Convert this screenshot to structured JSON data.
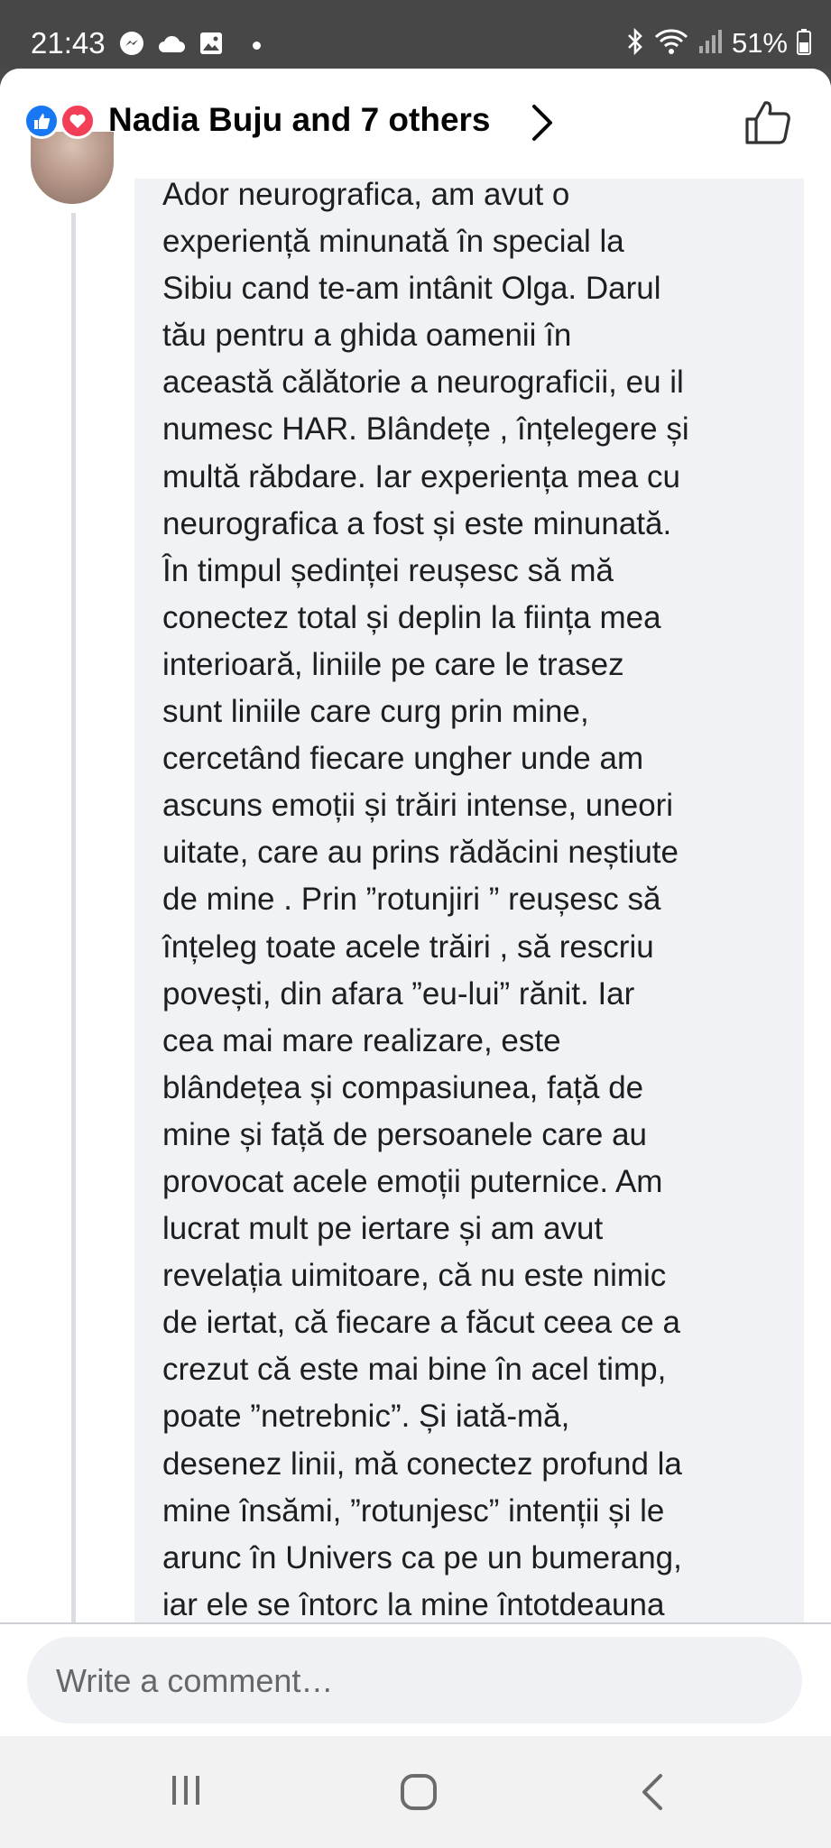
{
  "status_bar": {
    "time": "21:43",
    "battery": "51%",
    "icons": [
      "messenger-icon",
      "cloud-icon",
      "gallery-icon",
      "bluetooth-icon",
      "wifi-icon",
      "signal-icon",
      "battery-icon"
    ]
  },
  "header": {
    "reactions": [
      "like",
      "love"
    ],
    "title": "Nadia Buju and 7 others"
  },
  "comment": {
    "lines": [
      "Ador neurografica, am avut o",
      "experiență minunată în special la",
      "Sibiu cand te-am intânit Olga. Darul",
      "tău pentru a ghida oamenii în",
      "această călătorie a neurograficii, eu il",
      "numesc HAR. Blândețe , înțelegere și",
      "multă răbdare. Iar experiența mea cu",
      "neurografica a fost și este minunată.",
      "În timpul ședinței reușesc să mă",
      "conectez total și deplin la ființa mea",
      "interioară, liniile pe care le trasez",
      "sunt liniile care curg prin mine,",
      "cercetând fiecare ungher unde am",
      "ascuns emoții și trăiri intense, uneori",
      "uitate, care au prins rădăcini neștiute",
      "de mine . Prin ”rotunjiri ” reușesc să",
      "înțeleg toate acele trăiri , să rescriu",
      "povești, din afara ”eu-lui” rănit. Iar",
      "cea mai mare realizare, este",
      "blândețea și compasiunea, față de",
      "mine și față de persoanele care au",
      "provocat acele emoții puternice. Am",
      "lucrat mult pe iertare și am avut",
      "revelația uimitoare, că nu este nimic",
      "de iertat, că fiecare a făcut ceea ce a",
      "crezut că este mai bine în acel timp,",
      "poate ”netrebnic”.  Și iată-mă,",
      "desenez linii, mă conectez profund la",
      "mine însămi, ”rotunjesc” intenții și le",
      "arunc în Univers ca pe un bumerang,",
      "iar ele se întorc la mine întotdeauna"
    ]
  },
  "composer": {
    "placeholder": "Write a comment…"
  },
  "colors": {
    "accent": "#1877f2",
    "love": "#f33e58",
    "bubble": "#f0f2f5"
  }
}
